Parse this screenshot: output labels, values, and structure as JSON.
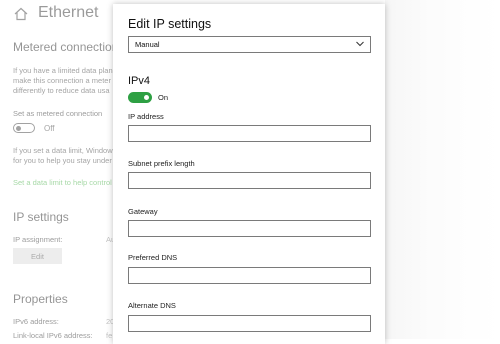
{
  "background": {
    "title": "Ethernet",
    "metered": {
      "heading": "Metered connection",
      "description_lines": [
        "If you have a limited data plan",
        "make this connection a meter",
        "differently to reduce data usa"
      ],
      "toggle_label": "Set as metered connection",
      "toggle_state": "Off",
      "limit_lines": [
        "If you set a data limit, Window",
        "for you to help you stay under"
      ],
      "limit_link": "Set a data limit to help control"
    },
    "ip_settings": {
      "heading": "IP settings",
      "assignment_label": "IP assignment:",
      "assignment_value": "Au",
      "edit_label": "Edit"
    },
    "properties": {
      "heading": "Properties",
      "rows": [
        {
          "label": "IPv6 address:",
          "value": "20"
        },
        {
          "label": "Link-local IPv6 address:",
          "value": "fe"
        }
      ]
    }
  },
  "dialog": {
    "title": "Edit IP settings",
    "mode_selected": "Manual",
    "section": "IPv4",
    "ipv4_toggle_state": "On",
    "fields": [
      {
        "label": "IP address",
        "value": ""
      },
      {
        "label": "Subnet prefix length",
        "value": ""
      },
      {
        "label": "Gateway",
        "value": ""
      },
      {
        "label": "Preferred DNS",
        "value": ""
      },
      {
        "label": "Alternate DNS",
        "value": ""
      }
    ]
  },
  "colors": {
    "toggle_on": "#2ea043",
    "link": "#3aa93a"
  }
}
